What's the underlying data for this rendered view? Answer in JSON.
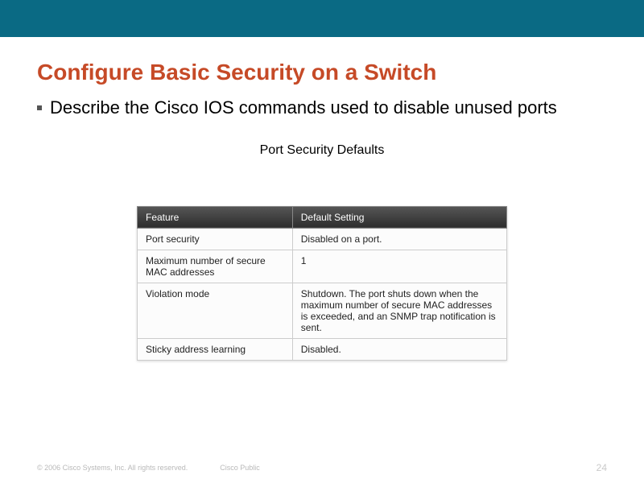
{
  "header": {
    "title": "Configure Basic Security on a Switch"
  },
  "bullet": {
    "text": "Describe the Cisco IOS commands used to disable unused ports"
  },
  "figure": {
    "title": "Port Security Defaults",
    "columns": {
      "feature": "Feature",
      "setting": "Default Setting"
    },
    "rows": [
      {
        "feature": "Port security",
        "setting": "Disabled on a port."
      },
      {
        "feature": "Maximum number of secure MAC addresses",
        "setting": "1"
      },
      {
        "feature": "Violation mode",
        "setting": "Shutdown. The port shuts down when the maximum number of secure MAC addresses is exceeded, and an SNMP trap notification is sent."
      },
      {
        "feature": "Sticky address learning",
        "setting": "Disabled."
      }
    ]
  },
  "footer": {
    "copyright": "© 2006 Cisco Systems, Inc. All rights reserved.",
    "label": "Cisco Public",
    "page": "24"
  }
}
